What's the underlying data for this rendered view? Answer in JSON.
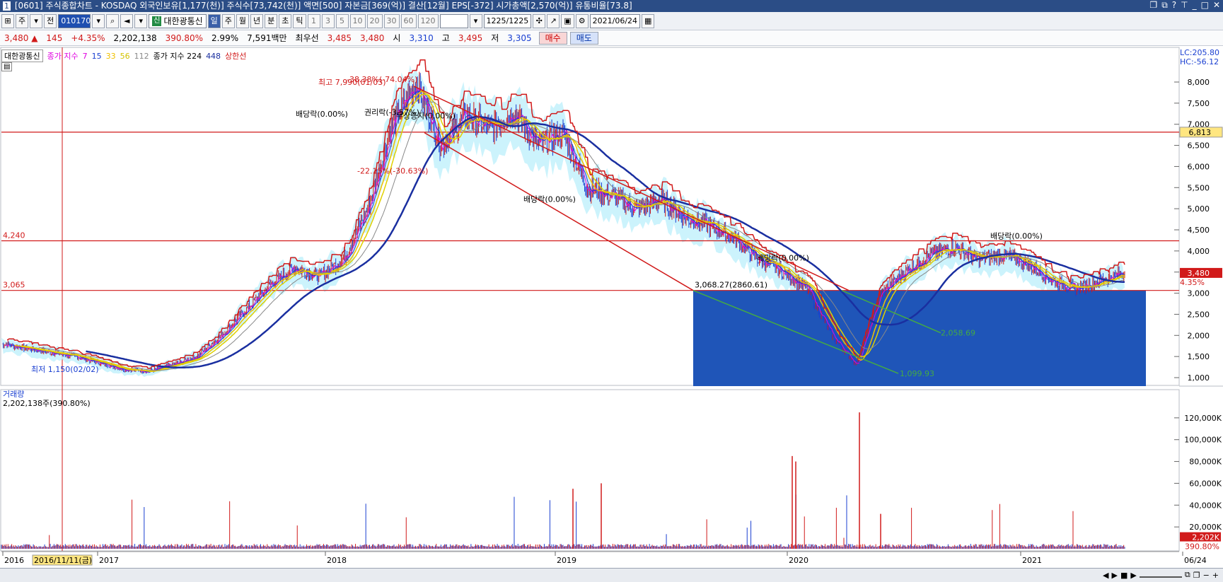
{
  "window": {
    "number": "1",
    "title": "[0601] 주식종합차트 - KOSDAQ 외국인보유[1,177(천)] 주식수[73,742(천)] 액면[500] 자본금[369(억)] 결산[12월] EPS[-372] 시가총액[2,570(억)] 유통비율[73.8]"
  },
  "toolbar": {
    "stock_code": "010170",
    "stock_name": "대한광통신",
    "name_badge": "신",
    "type_label": "주",
    "jeon_label": "전",
    "periods": [
      "일",
      "주",
      "월",
      "년",
      "분",
      "초",
      "틱"
    ],
    "active_period": "일",
    "numbers": [
      "1",
      "3",
      "5",
      "10",
      "20",
      "30",
      "60",
      "120"
    ],
    "count": "1225/1225",
    "date": "2021/06/24"
  },
  "quote": {
    "price": "3,480",
    "change_arrow": "▲",
    "change": "145",
    "change_pct": "+4.35%",
    "volume": "2,202,138",
    "volume_pct": "390.80%",
    "turnover": "2.99%",
    "amount": "7,591백만",
    "pref_label": "최우선",
    "ask": "3,485",
    "bid": "3,480",
    "open_label": "시",
    "open": "3,310",
    "high_label": "고",
    "high": "3,495",
    "low_label": "저",
    "low": "3,305",
    "buy_label": "매수",
    "sell_label": "매도"
  },
  "legend": {
    "name": "대한광통신",
    "ma_label": "종가 지수",
    "ma_values": [
      "7",
      "15",
      "33",
      "56",
      "112"
    ],
    "ma2_label": "종가 지수 224",
    "ma2_value": "448",
    "extra": "상한선"
  },
  "colors": {
    "up": "#d11a1a",
    "down": "#1a3fd1",
    "ma7": "#e000e0",
    "ma15": "#1a3fd1",
    "ma33": "#f0c000",
    "ma56": "#e0d000",
    "ma112": "#888888",
    "ma448": "#1a2fa0",
    "cloud": "#bff0fb",
    "box": "#1f55b8"
  },
  "chart_data": {
    "type": "line",
    "title": "",
    "xlabel": "",
    "ylabel": "",
    "y_ticks": [
      "8,000",
      "7,500",
      "7,000",
      "6,500",
      "6,000",
      "5,500",
      "5,000",
      "4,500",
      "4,000",
      "3,500",
      "3,000",
      "2,500",
      "2,000",
      "1,500",
      "1,000"
    ],
    "ylim": [
      1000,
      8000
    ],
    "x_ticks": [
      "2016",
      "2017",
      "2018",
      "2019",
      "2020",
      "2021",
      "06/24"
    ],
    "x_cursor_label": "2016/11/11(금)",
    "top_right_labels": [
      "LC:205.80",
      "HC:-56.12"
    ],
    "h_lines": [
      {
        "label": "6,813",
        "value": 6813
      },
      {
        "label": "4,240",
        "value": 4240
      },
      {
        "label": "3,065",
        "value": 3065
      }
    ],
    "current_price_label": "3,480",
    "current_pct_label": "4.35%",
    "annotations": [
      "최고 7,990(01/03)",
      "-38.38%(-74.04%)",
      "배당락(0.00%)",
      "권리락(-3.57%)",
      "무상증자(0.00%)",
      "-22.15%(-30.63%)",
      "배당락(0.00%)",
      "배당락(0.00%)",
      "배당락(0.00%)",
      "3,068.27(2860.61)",
      "2,058.69",
      "1,099.93",
      "최저 1,150(02/02)"
    ],
    "volume": {
      "label": "거래량",
      "value_label": "2,202,138주(390.80%)",
      "y_ticks": [
        "120,000K",
        "100,000K",
        "80,000K",
        "60,000K",
        "40,000K",
        "20,000K"
      ],
      "current_label": "2,202K",
      "current_pct": "390.80%"
    },
    "series": [
      {
        "name": "종가",
        "values": [
          1800,
          1700,
          1600,
          1500,
          1350,
          1200,
          1150,
          1300,
          1500,
          2000,
          2600,
          3200,
          3600,
          3400,
          3800,
          5000,
          7000,
          7990,
          6500,
          7200,
          6900,
          7300,
          6500,
          6800,
          5500,
          5300,
          5000,
          5200,
          4800,
          4600,
          4300,
          3800,
          3500,
          3100,
          2000,
          1300,
          3000,
          3500,
          3900,
          4100,
          3800,
          3900,
          3700,
          3300,
          3100,
          3300,
          3480
        ]
      }
    ]
  },
  "scrollbar": {
    "zoom_label": "1225"
  }
}
